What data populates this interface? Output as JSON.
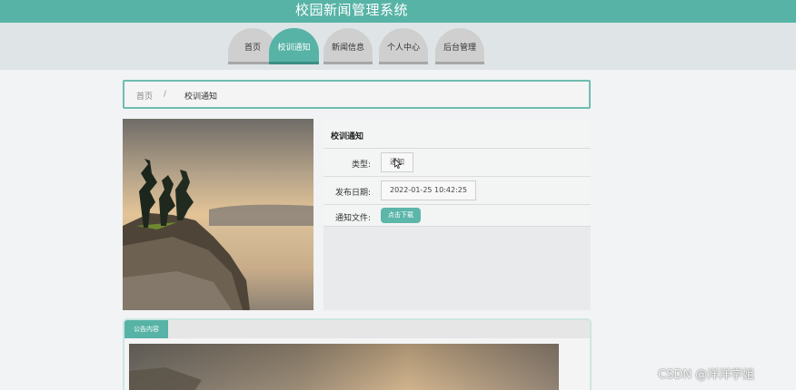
{
  "header": {
    "title": "校园新闻管理系统"
  },
  "nav": {
    "items": [
      {
        "label": "首页"
      },
      {
        "label": "校训通知",
        "active": true
      },
      {
        "label": "新闻信息"
      },
      {
        "label": "个人中心"
      },
      {
        "label": "后台管理"
      }
    ]
  },
  "breadcrumb": {
    "home": "首页",
    "separator": "/",
    "current": "校训通知"
  },
  "detail": {
    "title": "校训通知",
    "type_label": "类型:",
    "type_value": "通知",
    "date_label": "发布日期:",
    "date_value": "2022-01-25 10:42:25",
    "file_label": "通知文件:",
    "download_label": "点击下载"
  },
  "content": {
    "tab_label": "公告内容"
  },
  "watermark": "CSDN @洋洋学姐",
  "colors": {
    "accent": "#57b3a6",
    "nav_band": "#dfe5e7",
    "background": "#f1f3f4"
  }
}
